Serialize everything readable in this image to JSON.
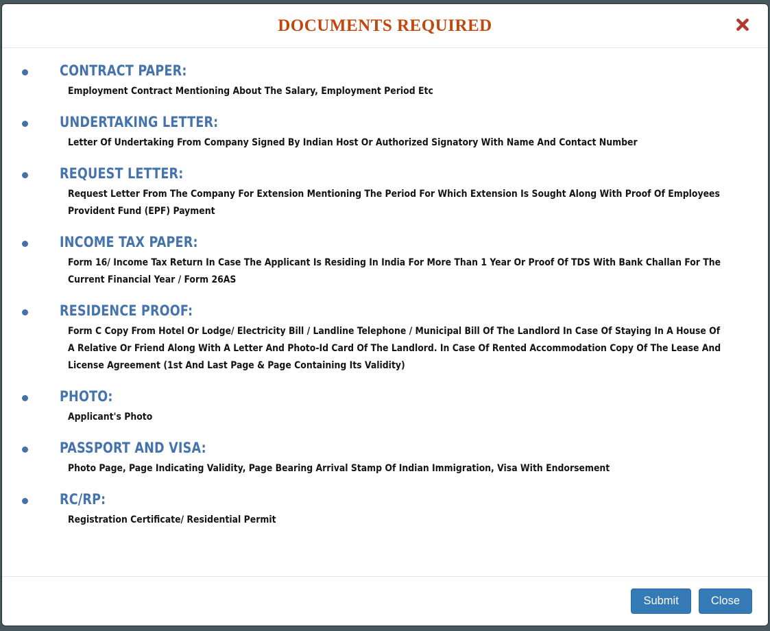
{
  "modal": {
    "title": "DOCUMENTS REQUIRED",
    "close_icon": "close-cross-icon",
    "title_color": "#c1470d",
    "heading_color": "#4573ab",
    "accent_button_color": "#337ab7",
    "documents": [
      {
        "heading": "CONTRACT PAPER:",
        "description": "Employment Contract Mentioning About The Salary, Employment Period Etc"
      },
      {
        "heading": "UNDERTAKING LETTER:",
        "description": "Letter Of Undertaking From Company Signed By Indian Host Or Authorized Signatory With Name And Contact Number"
      },
      {
        "heading": "REQUEST LETTER:",
        "description": "Request Letter From The Company For Extension Mentioning The Period For Which Extension Is Sought Along With Proof Of Employees Provident Fund (EPF) Payment"
      },
      {
        "heading": "INCOME TAX PAPER:",
        "description": "Form 16/ Income Tax Return In Case The Applicant Is Residing In India For More Than 1 Year Or Proof Of TDS With Bank Challan For The Current Financial Year / Form 26AS"
      },
      {
        "heading": "RESIDENCE PROOF:",
        "description": "Form C Copy From Hotel Or Lodge/ Electricity Bill / Landline Telephone / Municipal Bill Of The Landlord In Case Of Staying In A House Of A Relative Or Friend Along With A Letter And Photo-Id Card Of The Landlord. In Case Of Rented Accommodation Copy Of The Lease And License Agreement (1st And Last Page & Page Containing Its Validity)"
      },
      {
        "heading": "PHOTO:",
        "description": "Applicant's Photo"
      },
      {
        "heading": "PASSPORT AND VISA:",
        "description": "Photo Page, Page Indicating Validity, Page Bearing Arrival Stamp Of Indian Immigration, Visa With Endorsement"
      },
      {
        "heading": "RC/RP:",
        "description": "Registration Certificate/ Residential Permit"
      }
    ],
    "footer": {
      "submit_label": "Submit",
      "close_label": "Close"
    }
  }
}
